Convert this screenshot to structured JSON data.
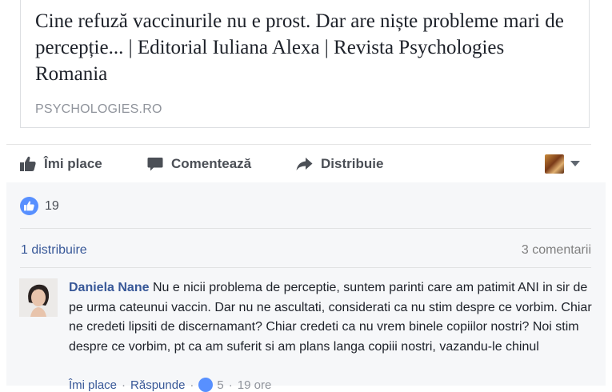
{
  "link_preview": {
    "title": "Cine refuză vaccinurile nu e prost. Dar are niște probleme mari de percepție... | Editorial Iuliana Alexa | Revista Psychologies Romania",
    "domain": "PSYCHOLOGIES.RO"
  },
  "actions": {
    "like_label": "Îmi place",
    "comment_label": "Comentează",
    "share_label": "Distribuie",
    "like_icon": "thumbs-up-icon",
    "comment_icon": "speech-bubble-icon",
    "share_icon": "share-arrow-icon"
  },
  "feedback": {
    "like_count": "19",
    "shares_text": "1 distribuire",
    "comments_text": "3 comentarii"
  },
  "comment": {
    "author": "Daniela Nane",
    "text": "Nu e nicii problema de perceptie, suntem parinti care am patimit ANI in sir de pe urma cateunui vaccin. Dar nu ne ascultati, considerati ca nu stim despre ce vorbim. Chiar ne credeti lipsiti de discernamant? Chiar credeti ca nu vrem binele copiilor nostri? Noi stim despre ce vorbim, pt ca am suferit si am plans langa copiii nostri, vazandu-le chinul",
    "like_label": "Îmi place",
    "reply_label": "Răspunde",
    "reaction_count": "5",
    "time": "19 ore"
  },
  "colors": {
    "link_blue": "#385898",
    "like_blue": "#5890ff",
    "text_dark": "#1d2129",
    "text_grey": "#90949c"
  }
}
